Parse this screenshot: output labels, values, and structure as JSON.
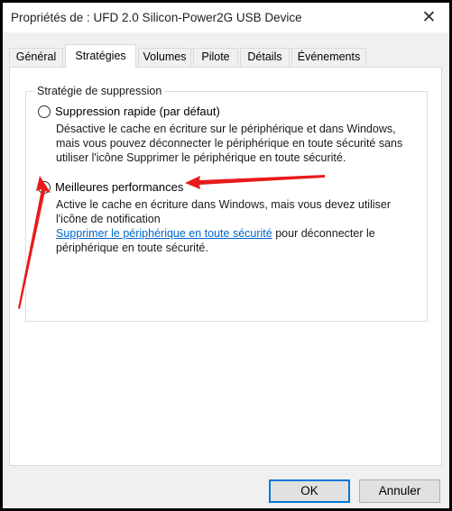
{
  "window": {
    "title": "Propriétés de : UFD 2.0 Silicon-Power2G USB Device",
    "close_glyph": "✕"
  },
  "tabs": [
    {
      "label": "Général"
    },
    {
      "label": "Stratégies"
    },
    {
      "label": "Volumes"
    },
    {
      "label": "Pilote"
    },
    {
      "label": "Détails"
    },
    {
      "label": "Événements"
    }
  ],
  "active_tab": "Stratégies",
  "policy_group": {
    "legend": "Stratégie de suppression",
    "options": [
      {
        "label": "Suppression rapide (par défaut)",
        "selected": false,
        "description": "Désactive le cache en écriture sur le périphérique et dans Windows, mais vous pouvez déconnecter le périphérique en toute sécurité sans utiliser l'icône Supprimer le périphérique en toute sécurité."
      },
      {
        "label": "Meilleures performances",
        "selected": true,
        "description": "Active le cache en écriture dans Windows, mais vous devez utiliser l'icône de notification",
        "link_text": "Supprimer le périphérique en toute sécurité",
        "description_suffix": " pour déconnecter le périphérique en toute sécurité."
      }
    ]
  },
  "buttons": {
    "ok": "OK",
    "cancel": "Annuler"
  },
  "colors": {
    "accent": "#0078d7",
    "link": "#0066cc",
    "annotation_arrow": "#e81b1b"
  },
  "icons": {
    "close": "close-icon",
    "radio_checked": "radio-checked-icon",
    "radio_unchecked": "radio-unchecked-icon"
  }
}
